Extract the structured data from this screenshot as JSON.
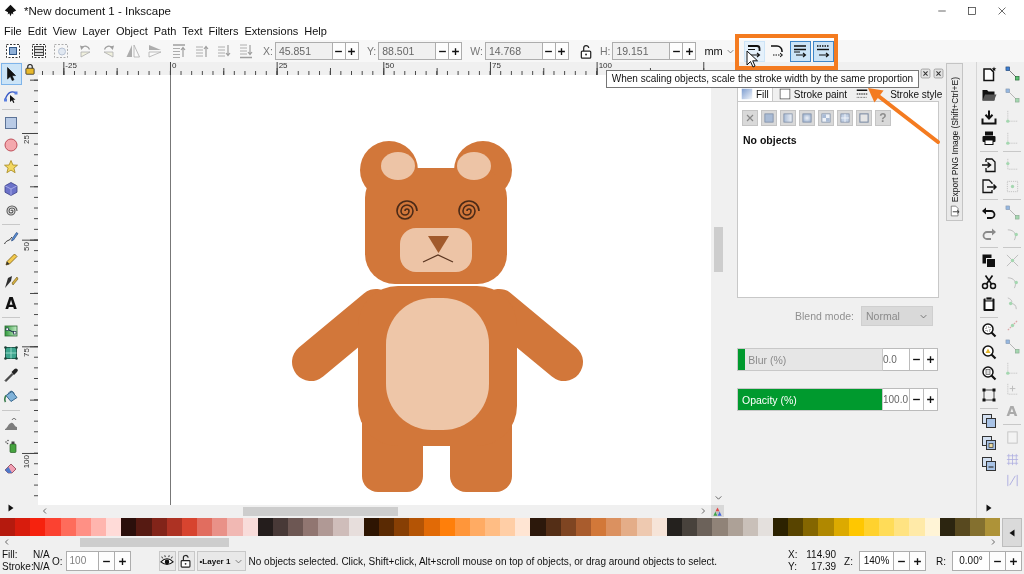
{
  "window": {
    "title": "*New document 1 - Inkscape"
  },
  "menu": [
    "File",
    "Edit",
    "View",
    "Layer",
    "Object",
    "Path",
    "Text",
    "Filters",
    "Extensions",
    "Help"
  ],
  "toolbar": {
    "commands": [
      {
        "kind": "selectall",
        "disabled": false
      },
      {
        "kind": "selectlayers",
        "disabled": false
      },
      {
        "kind": "deselect",
        "disabled": true
      },
      {
        "kind": "rotateleft",
        "disabled": true
      },
      {
        "kind": "rotateright",
        "disabled": true
      },
      {
        "kind": "fliph",
        "disabled": true
      },
      {
        "kind": "flipv",
        "disabled": true
      },
      {
        "kind": "top",
        "disabled": true
      },
      {
        "kind": "raise",
        "disabled": true
      },
      {
        "kind": "lower",
        "disabled": true
      },
      {
        "kind": "bottom",
        "disabled": true
      }
    ],
    "fields": [
      {
        "label": "X:",
        "value": "45.851",
        "disabled": true
      },
      {
        "label": "Y:",
        "value": "88.501",
        "disabled": true
      },
      {
        "label": "W:",
        "value": "14.768",
        "disabled": true
      },
      {
        "label": "H:",
        "value": "19.151",
        "disabled": true
      }
    ],
    "lock": {
      "locked": false
    },
    "unit": "mm",
    "scale_toggles": [
      {
        "kind": "stroke",
        "on": false,
        "hovered": true
      },
      {
        "kind": "corners",
        "on": false,
        "hovered": false
      },
      {
        "kind": "gradients",
        "on": true,
        "hovered": false
      },
      {
        "kind": "patterns",
        "on": true,
        "hovered": false
      }
    ]
  },
  "tooltip": "When scaling objects, scale the stroke width by the same proportion",
  "tools": [
    {
      "kind": "selector",
      "selected": true
    },
    {
      "kind": "node",
      "selected": false
    },
    {
      "kind": "rect",
      "selected": false
    },
    {
      "kind": "ellipse",
      "selected": false
    },
    {
      "kind": "star",
      "selected": false
    },
    {
      "kind": "box",
      "selected": false
    },
    {
      "kind": "spiral",
      "selected": false
    },
    {
      "kind": "pen",
      "selected": false
    },
    {
      "kind": "pencil",
      "selected": false
    },
    {
      "kind": "calligraphy",
      "selected": false
    },
    {
      "kind": "text",
      "label": "A",
      "selected": false
    },
    {
      "kind": "gradient",
      "selected": false
    },
    {
      "kind": "mesh",
      "selected": false
    },
    {
      "kind": "dropper",
      "selected": false
    },
    {
      "kind": "bucket",
      "selected": false
    },
    {
      "kind": "tweak",
      "selected": false
    },
    {
      "kind": "spray",
      "selected": false
    },
    {
      "kind": "eraser",
      "selected": false
    }
  ],
  "rulers": {
    "guides_locked": true,
    "horizontal": [
      "-25",
      "0",
      "25",
      "50",
      "75",
      "100"
    ],
    "vertical": [
      "25",
      "50",
      "75",
      "100"
    ]
  },
  "fill_stroke": {
    "tabs": [
      {
        "kind": "fill",
        "label": "Fill",
        "selected": true
      },
      {
        "kind": "paint",
        "label": "Stroke paint",
        "selected": false
      },
      {
        "kind": "style",
        "label": "Stroke style",
        "selected": false
      }
    ],
    "paint_types": [
      {
        "kind": "none"
      },
      {
        "kind": "flat"
      },
      {
        "kind": "linear"
      },
      {
        "kind": "radial"
      },
      {
        "kind": "pattern"
      },
      {
        "kind": "meshgrid"
      },
      {
        "kind": "swatch"
      },
      {
        "kind": "unset",
        "label": "?"
      }
    ],
    "message": "No objects",
    "blend": {
      "label": "Blend mode:",
      "value": "Normal",
      "disabled": true
    },
    "sliders": [
      {
        "label": "Blur (%)",
        "level": 0.05,
        "value": "0.0"
      },
      {
        "label": "Opacity (%)",
        "level": 1,
        "value": "100.0"
      }
    ]
  },
  "export_tab": "Export PNG Image (Shift+Ctrl+E)",
  "commands": [
    {
      "kind": "new",
      "disabled": false
    },
    {
      "kind": "open",
      "disabled": false
    },
    {
      "kind": "save",
      "disabled": false
    },
    {
      "kind": "print",
      "disabled": false
    },
    {
      "kind": "import",
      "disabled": false
    },
    {
      "kind": "export",
      "disabled": false
    },
    {
      "kind": "undo",
      "disabled": false
    },
    {
      "kind": "redo",
      "disabled": true
    },
    {
      "kind": "copy",
      "disabled": false
    },
    {
      "kind": "cut",
      "disabled": false
    },
    {
      "kind": "paste",
      "disabled": false
    },
    {
      "kind": "zoomselection",
      "disabled": false
    },
    {
      "kind": "zoomdrawing",
      "disabled": false
    },
    {
      "kind": "zoompage",
      "disabled": false
    },
    {
      "kind": "zoomfit",
      "disabled": false
    },
    {
      "kind": "duplicate",
      "disabled": false
    },
    {
      "kind": "clone",
      "disabled": false
    },
    {
      "kind": "unlink",
      "disabled": false
    }
  ],
  "snap": [
    {
      "kind": "nodes",
      "on": true
    },
    {
      "kind": "nodes",
      "on": false
    },
    {
      "kind": "corner",
      "on": false
    },
    {
      "kind": "corner",
      "on": false
    },
    {
      "kind": "edge",
      "on": false
    },
    {
      "kind": "center",
      "on": false
    },
    {
      "kind": "nodes",
      "on": false
    },
    {
      "kind": "curve",
      "on": false
    },
    {
      "kind": "cross",
      "on": false
    },
    {
      "kind": "curve",
      "on": false
    },
    {
      "kind": "cusp",
      "on": false
    },
    {
      "kind": "rotation",
      "on": false
    },
    {
      "kind": "nodes",
      "on": false
    },
    {
      "kind": "corner",
      "on": false
    },
    {
      "kind": "plus",
      "on": false
    },
    {
      "kind": "text",
      "label": "A",
      "on": false
    },
    {
      "kind": "page",
      "on": false
    },
    {
      "kind": "grid",
      "on": false
    },
    {
      "kind": "guide",
      "on": false
    }
  ],
  "palette": [
    {
      "color": "#b51a0e"
    },
    {
      "color": "#d81c0d"
    },
    {
      "color": "#f6220e"
    },
    {
      "color": "#fb4231"
    },
    {
      "color": "#fe6c5b"
    },
    {
      "color": "#ff9085"
    },
    {
      "color": "#ffb5ae"
    },
    {
      "color": "#ffdbd8"
    },
    {
      "color": "#2b0f0b"
    },
    {
      "color": "#561a12"
    },
    {
      "color": "#822419"
    },
    {
      "color": "#ad3223"
    },
    {
      "color": "#d7442f"
    },
    {
      "color": "#e16d5f"
    },
    {
      "color": "#e99188"
    },
    {
      "color": "#f1b8b3"
    },
    {
      "color": "#f8dcda"
    },
    {
      "color": "#241d1c"
    },
    {
      "color": "#483937"
    },
    {
      "color": "#6d5753"
    },
    {
      "color": "#917671"
    },
    {
      "color": "#b09995"
    },
    {
      "color": "#cfbdba"
    },
    {
      "color": "#e7dedc"
    },
    {
      "color": "#2e1502"
    },
    {
      "color": "#5a2a03"
    },
    {
      "color": "#873f04"
    },
    {
      "color": "#b45405"
    },
    {
      "color": "#e16a06"
    },
    {
      "color": "#ff7f0a"
    },
    {
      "color": "#ff963a"
    },
    {
      "color": "#ffab63"
    },
    {
      "color": "#ffbd84"
    },
    {
      "color": "#ffcea6"
    },
    {
      "color": "#ffe5d3"
    },
    {
      "color": "#2c180b"
    },
    {
      "color": "#542e16"
    },
    {
      "color": "#7f4522"
    },
    {
      "color": "#a95c2d"
    },
    {
      "color": "#d27839"
    },
    {
      "color": "#db9160"
    },
    {
      "color": "#e4ad88"
    },
    {
      "color": "#eec9b0"
    },
    {
      "color": "#f6e4d8"
    },
    {
      "color": "#24211e"
    },
    {
      "color": "#48423c"
    },
    {
      "color": "#6c625a"
    },
    {
      "color": "#908378"
    },
    {
      "color": "#ada197"
    },
    {
      "color": "#c9c0b9"
    },
    {
      "color": "#e4e0dd"
    },
    {
      "color": "#2c2200"
    },
    {
      "color": "#584400"
    },
    {
      "color": "#846600"
    },
    {
      "color": "#b08800"
    },
    {
      "color": "#dcaa00"
    },
    {
      "color": "#ffc700"
    },
    {
      "color": "#ffd22e"
    },
    {
      "color": "#ffdc58"
    },
    {
      "color": "#ffe382"
    },
    {
      "color": "#ffeaa8"
    },
    {
      "color": "#fff4d6"
    },
    {
      "color": "#2c2510"
    },
    {
      "color": "#58491f"
    },
    {
      "color": "#84702f"
    },
    {
      "color": "#ae9338"
    }
  ],
  "status": {
    "fill_label": "Fill:",
    "fill_value": "N/A",
    "stroke_label": "Stroke:",
    "stroke_value": "N/A",
    "opacity": {
      "label": "O:",
      "value": "100",
      "disabled": true
    },
    "layer_visible": true,
    "layer_locked": false,
    "layer": "•Layer 1",
    "message": "No objects selected. Click, Shift+click, Alt+scroll mouse on top of objects, or drag around objects to select.",
    "cursor": [
      {
        "label": "X:",
        "value": "114.90"
      },
      {
        "label": "Y:",
        "value": "17.39"
      }
    ],
    "zoom": {
      "label": "Z:",
      "value": "140%"
    },
    "rotation": {
      "label": "R:",
      "value": "0.00°"
    }
  }
}
